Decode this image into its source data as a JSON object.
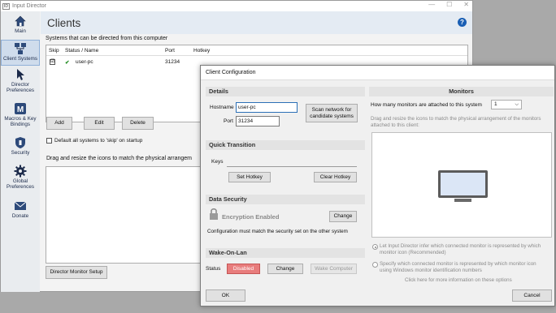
{
  "window": {
    "title": "Input Director",
    "controls": [
      "—",
      "☐",
      "✕"
    ]
  },
  "sidebar": {
    "items": [
      {
        "label": "Main",
        "icon": "home-icon"
      },
      {
        "label": "Client Systems",
        "icon": "network-icon"
      },
      {
        "label": "Director Preferences",
        "icon": "cursor-icon"
      },
      {
        "label": "Macros & Key Bindings",
        "icon": "macro-icon"
      },
      {
        "label": "Security",
        "icon": "shield-icon"
      },
      {
        "label": "Global Preferences",
        "icon": "gear-icon"
      },
      {
        "label": "Donate",
        "icon": "donate-icon"
      }
    ]
  },
  "main": {
    "title": "Clients",
    "help": "?",
    "subtitle": "Systems that can be directed from this computer",
    "table": {
      "headers": [
        "Skip",
        "Status / Name",
        "Port",
        "Hotkey"
      ],
      "rows": [
        {
          "skip": "☑",
          "status": "✔",
          "name": "user-pc",
          "port": "31234",
          "hotkey": ""
        }
      ]
    },
    "buttons": {
      "add": "Add",
      "edit": "Edit",
      "delete": "Delete",
      "monitor_setup": "Director Monitor Setup"
    },
    "default_skip_label": "Default all systems to 'skip' on startup",
    "drag_text": "Drag and resize the icons to match the physical arrangem"
  },
  "dialog": {
    "title": "Client Configuration",
    "details": {
      "heading": "Details",
      "hostname_label": "Hostname",
      "hostname_value": "user-pc",
      "port_label": "Port",
      "port_value": "31234",
      "scan_button_line1": "Scan network for",
      "scan_button_line2": "candidate systems"
    },
    "quick_transition": {
      "heading": "Quick Transition",
      "keys_label": "Keys",
      "set_hotkey": "Set Hotkey",
      "clear_hotkey": "Clear Hotkey"
    },
    "data_security": {
      "heading": "Data Security",
      "status": "Encryption Enabled",
      "change": "Change",
      "note": "Configuration must match the security set on the other system"
    },
    "wake_on_lan": {
      "heading": "Wake-On-Lan",
      "status_label": "Status",
      "status_value": "Disabled",
      "change": "Change",
      "wake": "Wake Computer"
    },
    "monitors": {
      "heading": "Monitors",
      "question": "How many monitors are attached to this system",
      "count": "1",
      "hint_line1": "Drag and resize the icons to match the physical arrangement of the monitors",
      "hint_line2": "attached to this client:",
      "radio1_line1": "Let Input Director infer which connected monitor is represented by which",
      "radio1_line2": "monitor icon (Recommended)",
      "radio2_line1": "Specify which connected monitor is represented by which monitor icon",
      "radio2_line2": "using Windows monitor identification numbers",
      "more_info": "Click here for more information on these options"
    },
    "ok": "OK",
    "cancel": "Cancel"
  },
  "colors": {
    "accent": "#1a5fb4",
    "disabled_status": "#e87c7c"
  }
}
